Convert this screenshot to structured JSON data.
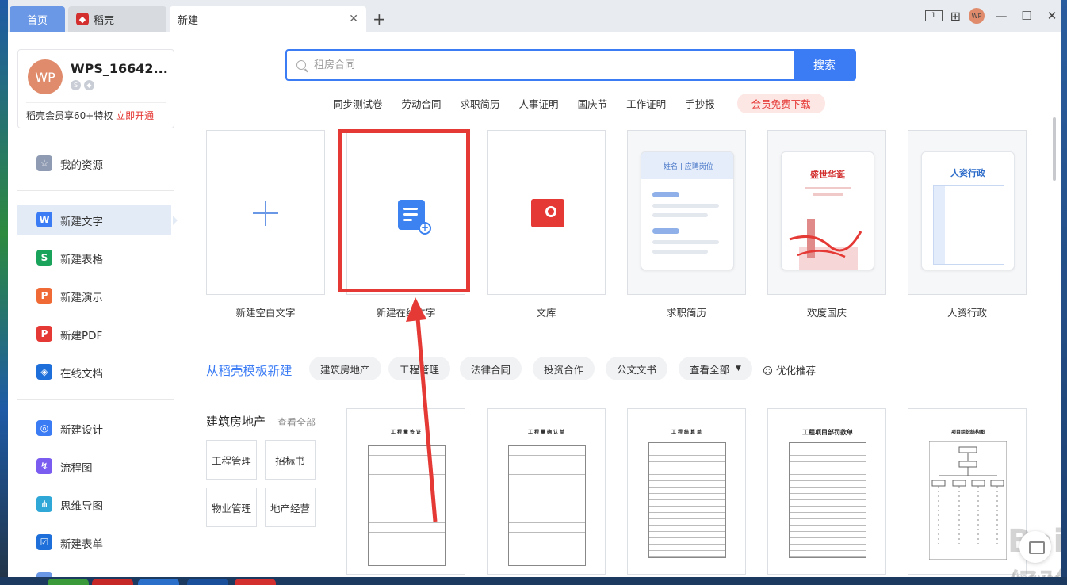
{
  "titlebar": {
    "tabs": [
      {
        "label": "首页"
      },
      {
        "label": "稻壳"
      },
      {
        "label": "新建"
      }
    ],
    "avatar_text": "WP"
  },
  "sidebar": {
    "user": {
      "avatar_text": "WP",
      "name": "WPS_16642...",
      "vip_text": "稻壳会员享60+特权",
      "vip_link": "立即开通"
    },
    "items": [
      {
        "label": "我的资源",
        "icon": "star-icon",
        "color": "#8f9bb3"
      },
      {
        "label": "新建文字",
        "icon": "word-icon",
        "color": "#3b7cf5"
      },
      {
        "label": "新建表格",
        "icon": "sheet-icon",
        "color": "#1aa35b"
      },
      {
        "label": "新建演示",
        "icon": "slides-icon",
        "color": "#f06a35"
      },
      {
        "label": "新建PDF",
        "icon": "pdf-icon",
        "color": "#e53935"
      },
      {
        "label": "在线文档",
        "icon": "online-doc-icon",
        "color": "#1e6fd9"
      },
      {
        "label": "新建设计",
        "icon": "design-icon",
        "color": "#3b7cf5"
      },
      {
        "label": "流程图",
        "icon": "flowchart-icon",
        "color": "#7b5cf0"
      },
      {
        "label": "思维导图",
        "icon": "mindmap-icon",
        "color": "#2fa8d8"
      },
      {
        "label": "新建表单",
        "icon": "form-icon",
        "color": "#1e6fd9"
      }
    ]
  },
  "search": {
    "placeholder": "租房合同",
    "button": "搜索",
    "hot_words": [
      "同步测试卷",
      "劳动合同",
      "求职简历",
      "人事证明",
      "国庆节",
      "工作证明",
      "手抄报"
    ],
    "vip_download": "会员免费下载"
  },
  "cards": [
    {
      "label": "新建空白文字"
    },
    {
      "label": "新建在线文字"
    },
    {
      "label": "文库"
    },
    {
      "label": "求职简历",
      "preview_header": "姓名 | 应聘岗位"
    },
    {
      "label": "欢度国庆",
      "preview_title": "盛世华诞"
    },
    {
      "label": "人资行政",
      "preview_title": "人资行政"
    }
  ],
  "templates": {
    "title": "从稻壳模板新建",
    "chips": [
      "建筑房地产",
      "工程管理",
      "法律合同",
      "投资合作",
      "公文文书",
      "查看全部"
    ],
    "optimize": "优化推荐",
    "category": {
      "title": "建筑房地产",
      "see_all": "查看全部",
      "items": [
        "工程管理",
        "招标书",
        "物业管理",
        "地产经营"
      ]
    },
    "docs": [
      {
        "title": "工程量签证"
      },
      {
        "title": "工程量确认单"
      },
      {
        "title": "工程结算单"
      },
      {
        "title": "工程项目部罚款单"
      },
      {
        "title": "项目组织结构图"
      }
    ]
  },
  "watermark": {
    "main": "Baidu经验",
    "sub": "jingyan.baidu.com"
  },
  "colors": {
    "accent": "#3b7cf5",
    "highlight": "#e53935"
  }
}
